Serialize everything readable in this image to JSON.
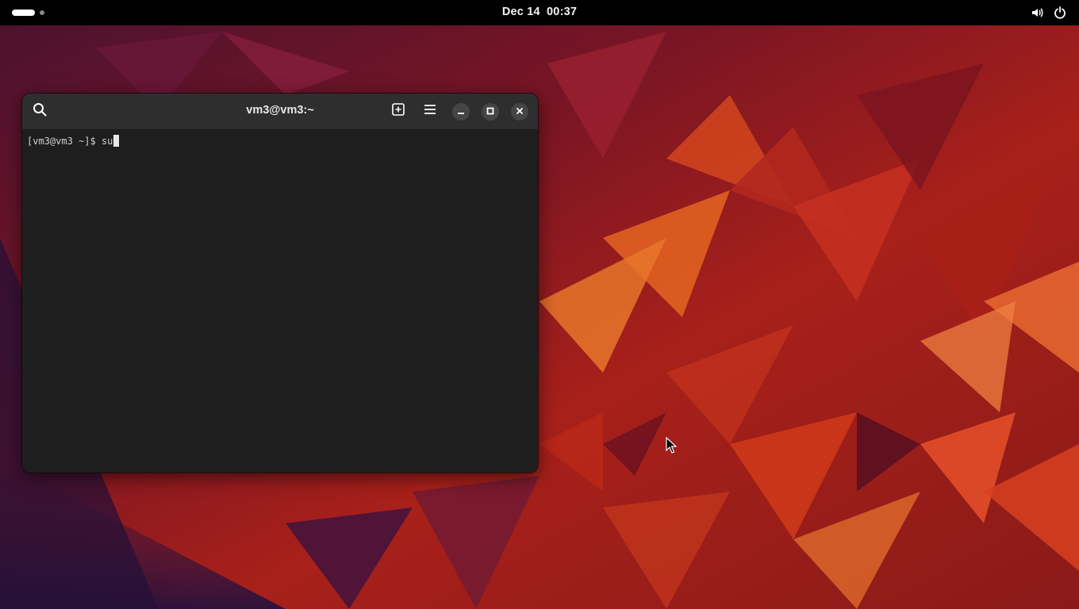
{
  "topbar": {
    "date": "Dec 14",
    "time": "00:37",
    "icons": [
      "activities-indicator",
      "volume-icon",
      "power-icon"
    ]
  },
  "terminal": {
    "title": "vm3@vm3:~",
    "prompt": "[vm3@vm3 ~]$ ",
    "command": "su",
    "header_icons": [
      "search-icon",
      "new-tab-icon",
      "menu-icon",
      "minimize-icon",
      "maximize-icon",
      "close-icon"
    ]
  },
  "colors": {
    "topbar_bg": "#000000",
    "terminal_bg": "#1e1e1e",
    "headerbar_bg": "#2e2e2e",
    "wallpaper_accent": "#c4301c"
  }
}
